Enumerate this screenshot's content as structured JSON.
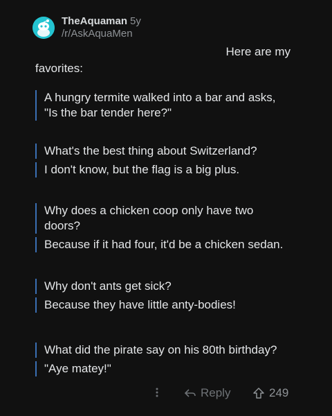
{
  "comment": {
    "author": "TheAquaman",
    "age": "5y",
    "flair": "/r/AskAquaMen",
    "intro_line1": "Here are my",
    "intro_line2": "favorites:",
    "jokes": [
      {
        "q1": "A hungry termite walked into a bar and asks,",
        "q2": "\"Is the bar tender here?\""
      },
      {
        "q": "What's the best thing about Switzerland?",
        "a": "I don't know, but the flag is a big plus."
      },
      {
        "q1": "Why does a chicken coop only have two",
        "q2": "doors?",
        "a": "Because if it had four, it'd be a chicken sedan."
      },
      {
        "q": "Why don't ants get sick?",
        "a": "Because they have little anty-bodies!"
      },
      {
        "q": "What did the pirate say on his 80th birthday?",
        "a": "\"Aye matey!\""
      }
    ]
  },
  "actions": {
    "more_icon": "vertical-dots",
    "reply_label": "Reply",
    "upvote_icon": "arrow-up-outline",
    "score": "249"
  },
  "colors": {
    "background": "#111111",
    "quote_bar": "#3b6fb4",
    "avatar": "#24c4d1"
  }
}
